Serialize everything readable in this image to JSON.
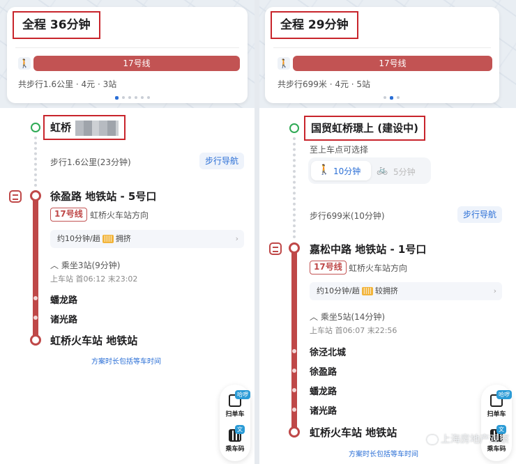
{
  "left": {
    "summary": {
      "total_time": "全程 36分钟",
      "line_label": "17号线",
      "info": "共步行1.6公里 · 4元 · 3站"
    },
    "start": {
      "name": "虹桥"
    },
    "walk": {
      "text": "步行1.6公里(23分钟)",
      "nav_label": "步行导航"
    },
    "board_station": "徐盈路 地铁站 - 5号口",
    "line_badge": "17号线",
    "direction": "虹桥火车站方向",
    "crowd": {
      "text": "约10分钟/趟",
      "level": "拥挤",
      "icon": "crowd-icon"
    },
    "ride": {
      "summary": "乘坐3站(9分钟)",
      "times": "上车站 首06:12 末23:02"
    },
    "stops": [
      "蟠龙路",
      "诸光路"
    ],
    "end_station": "虹桥火车站 地铁站",
    "footnote": "方案时长包括等车时间"
  },
  "right": {
    "summary": {
      "total_time": "全程 29分钟",
      "line_label": "17号线",
      "info": "共步行699米 · 4元 · 5站"
    },
    "start": {
      "name": "国贸虹桥璟上 (建设中)",
      "hint": "至上车点可选择"
    },
    "modes": {
      "walk": "10分钟",
      "bike": "5分钟"
    },
    "walk": {
      "text": "步行699米(10分钟)",
      "nav_label": "步行导航"
    },
    "board_station": "嘉松中路 地铁站 - 1号口",
    "line_badge": "17号线",
    "direction": "虹桥火车站方向",
    "crowd": {
      "text": "约10分钟/趟",
      "level": "较拥挤",
      "icon": "crowd-icon"
    },
    "ride": {
      "summary": "乘坐5站(14分钟)",
      "times": "上车站 首06:07 末22:56"
    },
    "stops": [
      "徐泾北城",
      "徐盈路",
      "蟠龙路",
      "诸光路"
    ],
    "end_station": "虹桥火车站 地铁站",
    "footnote": "方案时长包括等车时间"
  },
  "fab": {
    "scan_tag": "哈啰",
    "scan_label": "扫单车",
    "qr_tag": "文",
    "qr_label": "乘车码"
  },
  "watermark": "上海房地产观察",
  "colors": {
    "accent_red": "#c8242b",
    "line17": "#c25353",
    "link_blue": "#2b6fd6",
    "start_green": "#2faa55"
  }
}
